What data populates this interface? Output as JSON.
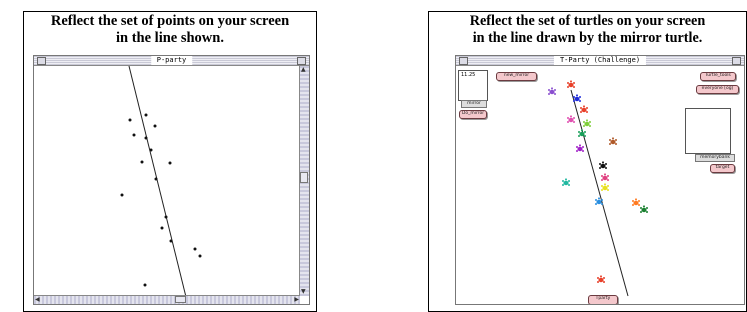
{
  "panel_left": {
    "caption_line1": "Reflect the set of points on your screen",
    "caption_line2": "in the line shown.",
    "window_title": "P-party"
  },
  "panel_right": {
    "caption_line1": "Reflect the set of turtles on your screen",
    "caption_line2": "in the line drawn by the mirror turtle.",
    "window_title": "T-Party (Challenge)",
    "slot_value": "11.25",
    "mirror_tag": "mirror",
    "buttons": {
      "new_mirror": "new_mirror",
      "do_mirror": "Do_mirror",
      "turtle_tools": "Turtle_tools",
      "everyone": "everyone [og]",
      "target": "target",
      "tparty": "Tparty"
    },
    "memory_tag": "memorybank"
  },
  "colors": {
    "pill_fill": "#f4c8cc",
    "turtles": [
      "#e8402a",
      "#8a4fcf",
      "#1e2bd8",
      "#e8402a",
      "#e050b0",
      "#7fcf3a",
      "#19a05a",
      "#b05a2a",
      "#a020c8",
      "#111111",
      "#e04080",
      "#20b8a0",
      "#e8e020",
      "#2a8fe0",
      "#ff7a20",
      "#1a8030"
    ]
  }
}
